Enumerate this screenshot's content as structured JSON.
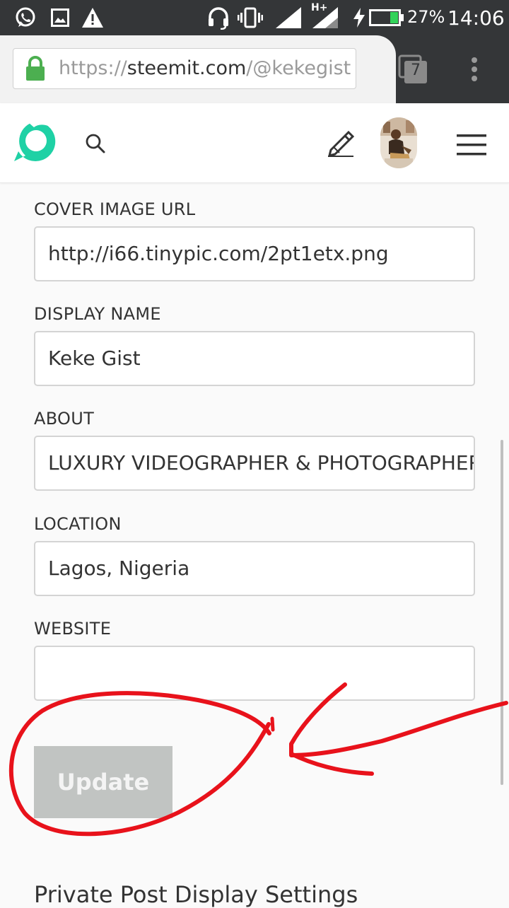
{
  "status_bar": {
    "battery_percent": "27%",
    "time": "14:06",
    "network_type": "H+",
    "icons": [
      "whatsapp-icon",
      "gallery-icon",
      "warning-icon",
      "headset-icon",
      "vibrate-icon",
      "signal-icon",
      "network-signal-icon",
      "charging-icon",
      "battery-icon"
    ]
  },
  "browser": {
    "url_scheme": "https://",
    "url_host": "steemit.com",
    "url_path": "/@kekegist",
    "tab_count": "7",
    "icons": [
      "lock-icon",
      "tabs-icon",
      "more-vert-icon"
    ]
  },
  "app_header": {
    "icons": [
      "steemit-logo-icon",
      "search-icon",
      "pencil-icon",
      "avatar",
      "hamburger-menu-icon"
    ]
  },
  "form": {
    "fields": [
      {
        "label": "COVER IMAGE URL",
        "value": "http://i66.tinypic.com/2pt1etx.png"
      },
      {
        "label": "DISPLAY NAME",
        "value": "Keke Gist"
      },
      {
        "label": "ABOUT",
        "value": "LUXURY VIDEOGRAPHER & PHOTOGRAPHER"
      },
      {
        "label": "LOCATION",
        "value": "Lagos, Nigeria"
      },
      {
        "label": "WEBSITE",
        "value": ""
      }
    ],
    "update_label": "Update"
  },
  "section": {
    "private_post_title": "Private Post Display Settings"
  },
  "colors": {
    "status_bar_bg": "#343638",
    "steemit_teal": "#1fd1a5",
    "lock_green": "#4caf50",
    "update_disabled_bg": "#c1c4c2",
    "annotation_red": "#e8121b"
  }
}
